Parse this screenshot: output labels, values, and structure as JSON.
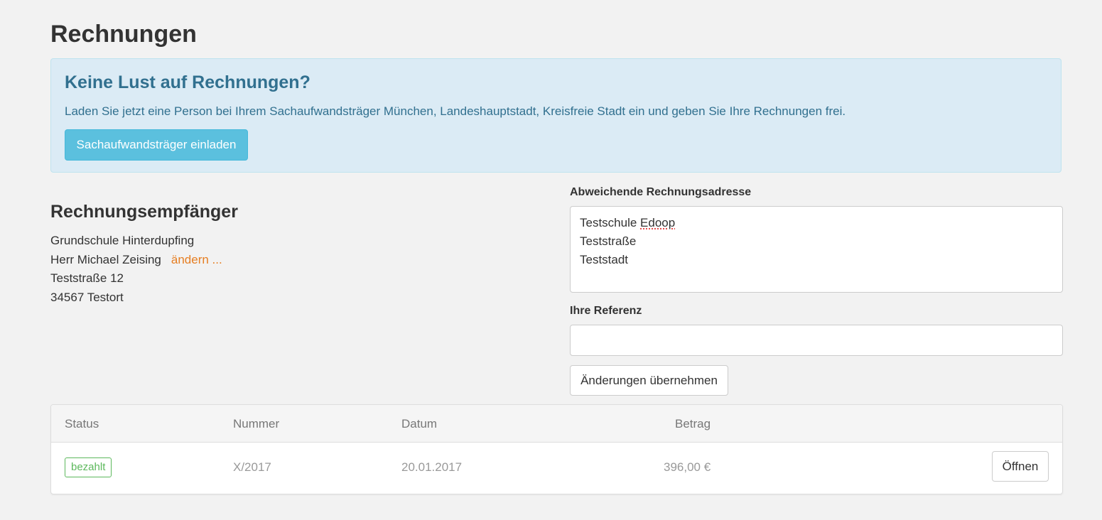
{
  "page": {
    "title": "Rechnungen"
  },
  "promo": {
    "title": "Keine Lust auf Rechnungen?",
    "text": "Laden Sie jetzt eine Person bei Ihrem Sachaufwandsträger München, Landeshauptstadt, Kreisfreie Stadt ein und geben Sie Ihre Rechnungen frei.",
    "button_label": "Sachaufwandsträger einladen"
  },
  "recipient": {
    "title": "Rechnungsempfänger",
    "lines": [
      "Grundschule Hinterdupfing",
      "Herr Michael Zeising",
      "Teststraße 12",
      "34567 Testort"
    ],
    "change_link": "ändern ..."
  },
  "form": {
    "alt_address_label": "Abweichende Rechnungsadresse",
    "alt_address_lines": {
      "line1_prefix": "Testschule ",
      "line1_flagged": "Edoop",
      "line2": "Teststraße",
      "line3": "Teststadt"
    },
    "reference_label": "Ihre Referenz",
    "reference_value": "",
    "apply_button": "Änderungen übernehmen"
  },
  "table": {
    "columns": [
      "Status",
      "Nummer",
      "Datum",
      "Betrag"
    ],
    "rows": [
      {
        "status": "bezahlt",
        "number": "X/2017",
        "date": "20.01.2017",
        "amount": "396,00 €",
        "action": "Öffnen"
      }
    ]
  },
  "colors": {
    "background": "#f2f2f2",
    "info_bg": "#dbebf5",
    "info_text": "#31708f",
    "info_button": "#5bc0de",
    "link": "#e67e22",
    "success": "#5cb85c"
  }
}
